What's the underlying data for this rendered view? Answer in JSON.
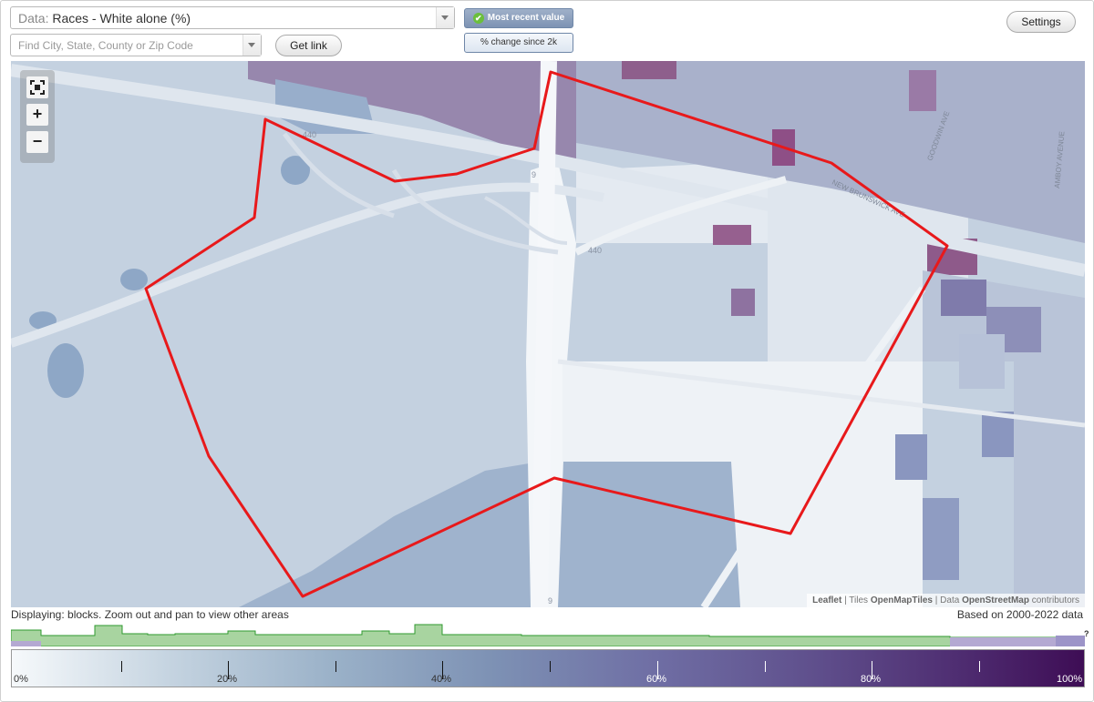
{
  "header": {
    "data_prefix": "Data:",
    "data_value": "Races - White alone (%)",
    "search_placeholder": "Find City, State, County or Zip Code",
    "get_link_label": "Get link",
    "settings_label": "Settings",
    "toggle_active_label": "Most recent value",
    "toggle_inactive_label": "% change since 2k"
  },
  "map": {
    "zoom_fullscreen_icon": "fullscreen-icon",
    "zoom_in_label": "+",
    "zoom_out_label": "−",
    "road_labels": [
      "440",
      "440",
      "9",
      "9",
      "NEW BRUNSWICK AVE",
      "GOODWIN AVE",
      "AMBOY AVENUE"
    ],
    "attribution": {
      "leaflet": "Leaflet",
      "sep1": " | Tiles ",
      "tiles": "OpenMapTiles",
      "sep2": " | Data ",
      "data": "OpenStreetMap",
      "suffix": " contributors"
    },
    "boundary_color": "#e8191b"
  },
  "footer": {
    "displaying_text": "Displaying: blocks. Zoom out and pan to view other areas",
    "based_on_text": "Based on 2000-2022 data",
    "hist_unknown_label": "?"
  },
  "legend": {
    "labels": [
      "0%",
      "20%",
      "40%",
      "60%",
      "80%",
      "100%"
    ],
    "colors": [
      "#f6f9fb",
      "#9ab1c8",
      "#6f6ea4",
      "#3e0d55"
    ]
  }
}
